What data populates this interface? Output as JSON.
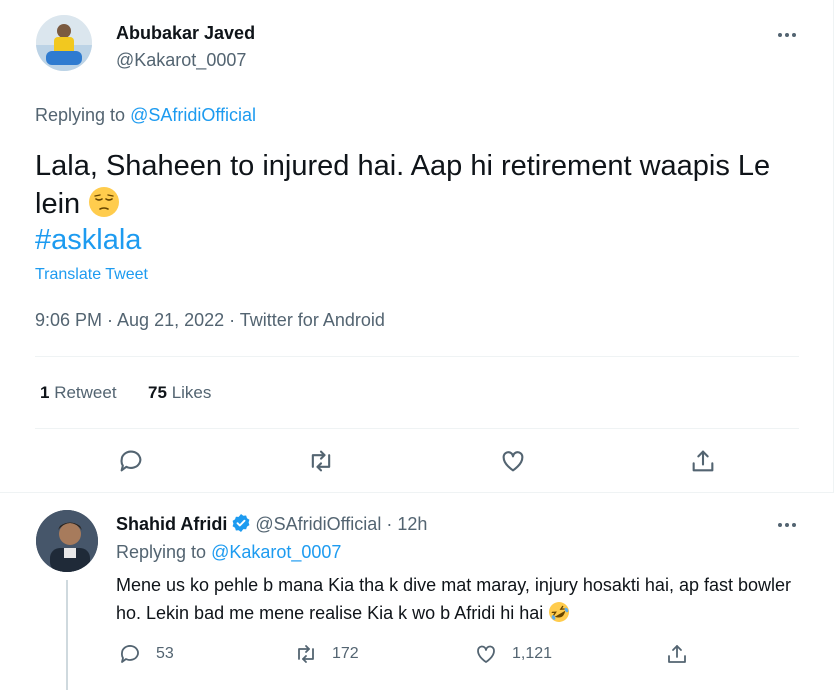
{
  "tweet": {
    "author_name": "Abubakar Javed",
    "author_handle": "@Kakarot_0007",
    "replying_prefix": "Replying to",
    "replying_to": "@SAfridiOfficial",
    "text": "Lala, Shaheen to injured hai. Aap hi retirement waapis Le lein",
    "emoji": "pensive-face",
    "hashtag": "#asklala",
    "translate_label": "Translate Tweet",
    "timestamp": "9:06 PM · Aug 21, 2022 · Twitter for Android",
    "retweet_count": "1",
    "retweet_label": "Retweet",
    "like_count": "75",
    "like_label": "Likes"
  },
  "reply": {
    "author_name": "Shahid Afridi",
    "author_handle": "@SAfridiOfficial",
    "time_ago": "· 12h",
    "replying_prefix": "Replying to",
    "replying_to": "@Kakarot_0007",
    "text": "Mene us ko pehle b mana Kia tha k dive mat maray, injury hosakti hai, ap fast bowler ho. Lekin bad me mene realise Kia k wo b Afridi hi hai",
    "emoji": "rolling-on-floor-laughing",
    "reply_count": "53",
    "retweet_count": "172",
    "like_count": "1,121"
  },
  "colors": {
    "link": "#1d9bf0",
    "muted": "#536471",
    "text": "#0f1419",
    "divider": "#eff3f4"
  }
}
